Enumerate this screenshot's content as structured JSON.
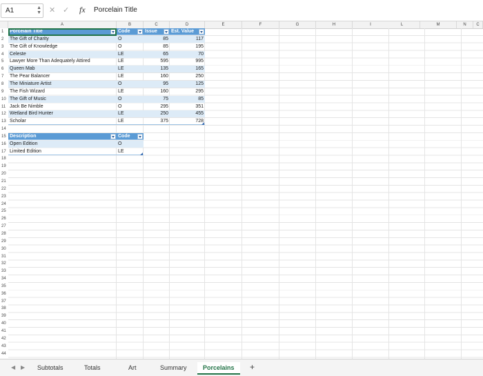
{
  "name_box": "A1",
  "formula": {
    "fx_label": "fx",
    "content": "Porcelain Title",
    "cancel_icon": "x-icon",
    "confirm_icon": "check-icon"
  },
  "columns": [
    "A",
    "B",
    "C",
    "D",
    "E",
    "F",
    "G",
    "H",
    "I",
    "J",
    "K",
    "L",
    "M",
    "N",
    "C"
  ],
  "rows": [
    "1",
    "2",
    "3",
    "4",
    "5",
    "6",
    "7",
    "8",
    "9",
    "10",
    "11",
    "12",
    "13",
    "14",
    "15",
    "16",
    "17",
    "18",
    "19",
    "20",
    "21",
    "22",
    "23",
    "24",
    "25",
    "26",
    "27",
    "28",
    "29",
    "30",
    "31",
    "32",
    "33",
    "34",
    "35",
    "36",
    "37",
    "38",
    "39",
    "40",
    "41",
    "42",
    "43",
    "44"
  ],
  "table1": {
    "headers": [
      "Porcelain Title",
      "Code",
      "Issue",
      "Est. Value"
    ],
    "rows": [
      [
        "The Gift of Charity",
        "O",
        "85",
        "117"
      ],
      [
        "The Gift of Knowledge",
        "O",
        "85",
        "195"
      ],
      [
        "Celeste",
        "LE",
        "65",
        "70"
      ],
      [
        "Lawyer More Than Adequately Attired",
        "LE",
        "595",
        "995"
      ],
      [
        "Queen Mab",
        "LE",
        "135",
        "165"
      ],
      [
        "The Pear Balancer",
        "LE",
        "160",
        "250"
      ],
      [
        "The Miniature Artist",
        "O",
        "95",
        "125"
      ],
      [
        "The Fish Wizard",
        "LE",
        "160",
        "295"
      ],
      [
        "The Gift of Music",
        "O",
        "75",
        "85"
      ],
      [
        "Jack Be Nimble",
        "O",
        "295",
        "351"
      ],
      [
        "Wetland Bird Hunter",
        "LE",
        "250",
        "455"
      ],
      [
        "Scholar",
        "LE",
        "375",
        "728"
      ]
    ]
  },
  "table2": {
    "headers": [
      "Description",
      "Code"
    ],
    "rows": [
      [
        "Open Edition",
        "O"
      ],
      [
        "Limited Edition",
        "LE"
      ]
    ]
  },
  "tabs": [
    "Subtotals",
    "Totals",
    "Art",
    "Summary",
    "Porcelains"
  ],
  "active_tab": "Porcelains",
  "add_sheet": "+",
  "colors": {
    "header_blue": "#5b9bd5",
    "band_blue": "#ddebf7",
    "excel_green": "#217346"
  }
}
